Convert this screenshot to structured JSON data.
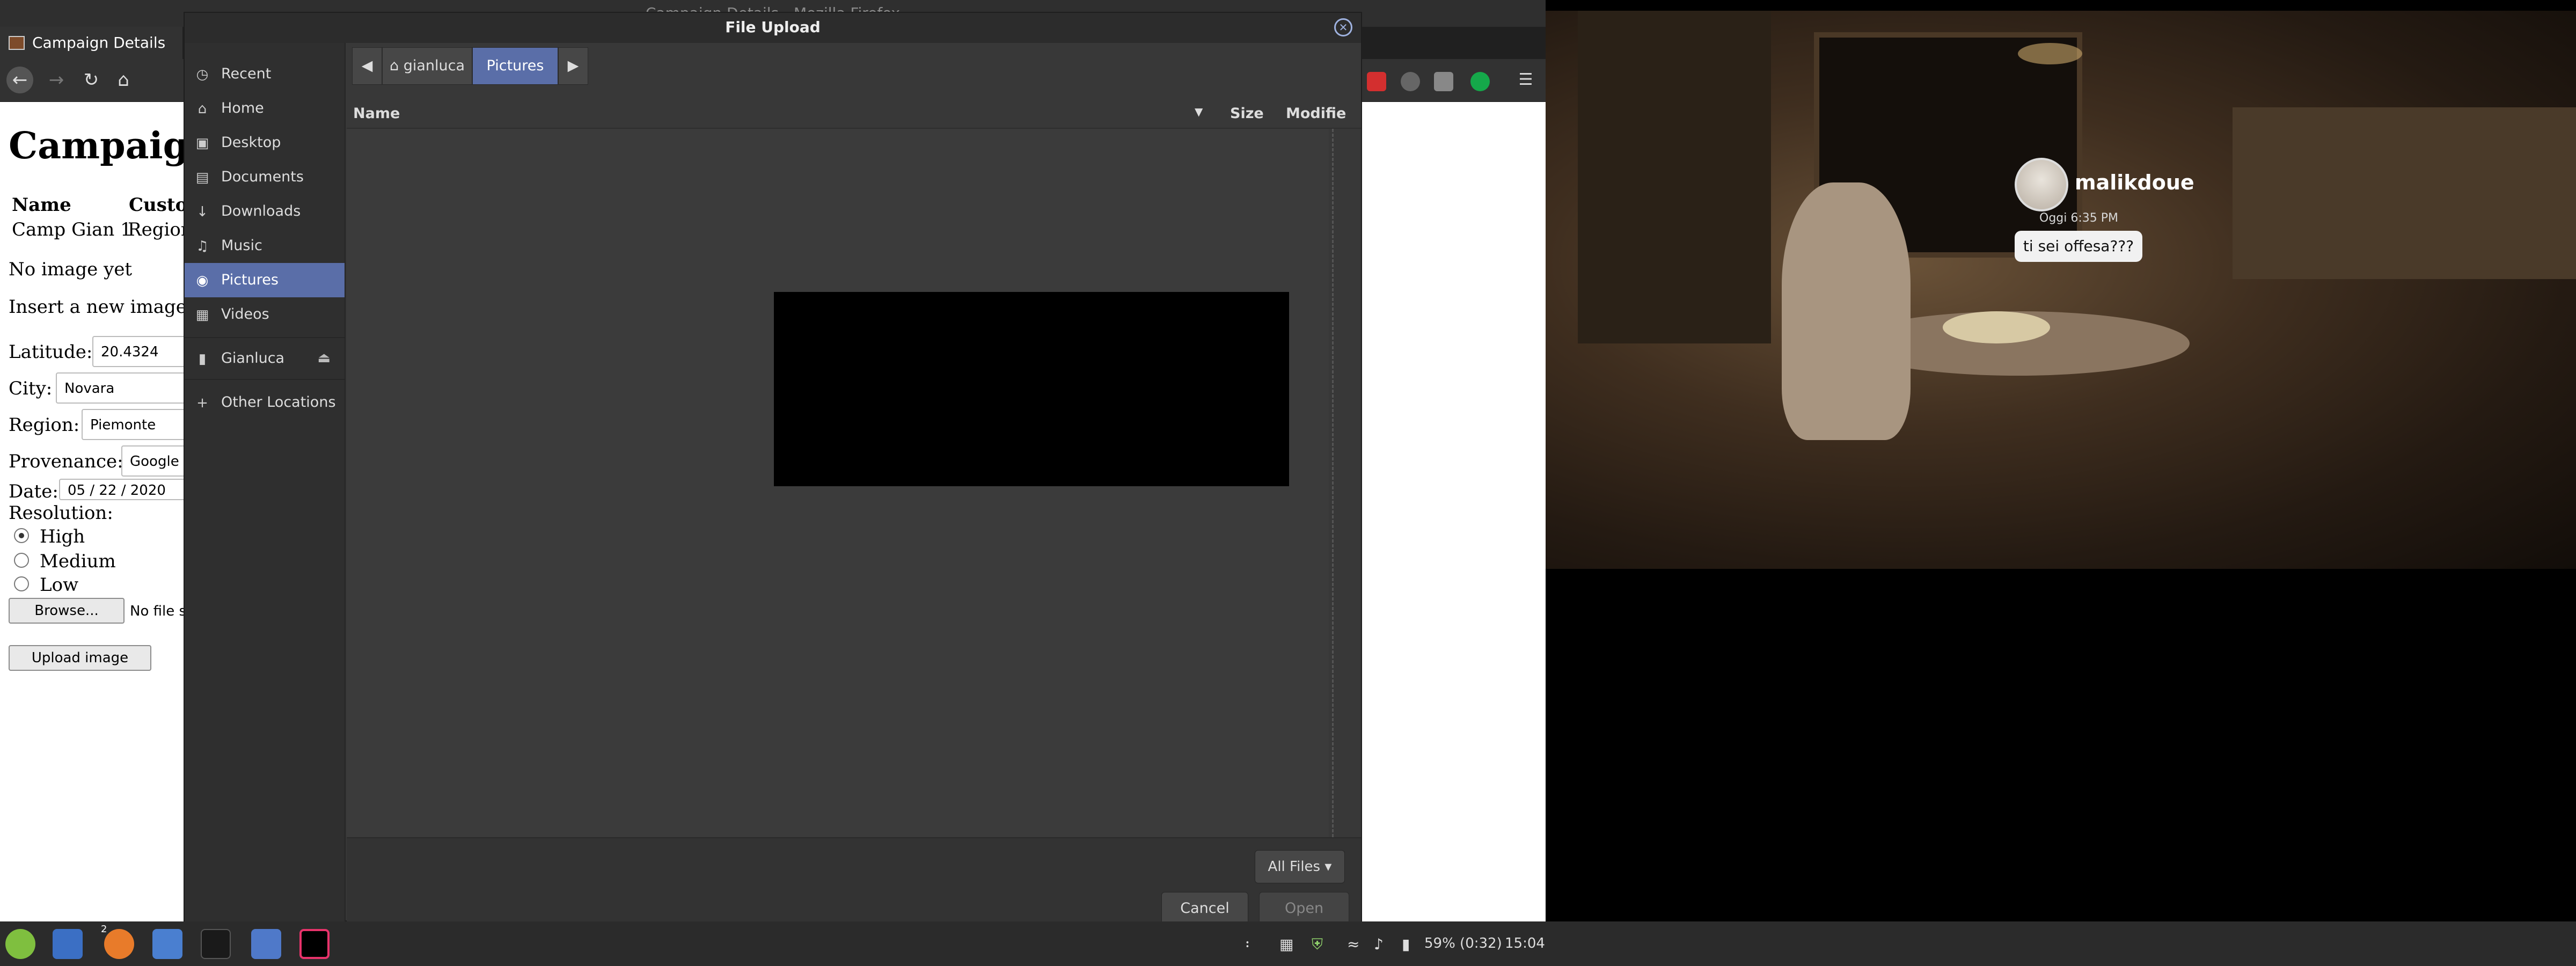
{
  "firefox": {
    "window_title": "Campaign Details - Mozilla Firefox",
    "tab_title": "Campaign Details",
    "page": {
      "heading": "Campaign",
      "table_headers": [
        "Name",
        "Custo"
      ],
      "table_row": [
        "Camp Gian 1",
        "Region"
      ],
      "no_image_text": "No image yet",
      "insert_image_text": "Insert a new image",
      "latitude_label": "Latitude:",
      "latitude_value": "20.4324",
      "city_label": "City:",
      "city_value": "Novara",
      "region_label": "Region:",
      "region_value": "Piemonte",
      "provenance_label": "Provenance:",
      "provenance_value": "Google",
      "date_label": "Date:",
      "date_value": "05 / 22 / 2020",
      "resolution_label": "Resolution:",
      "resolution_options": [
        "High",
        "Medium",
        "Low"
      ],
      "resolution_selected": "High",
      "browse_button": "Browse...",
      "no_file_text": "No file s",
      "upload_button": "Upload image"
    }
  },
  "dialog": {
    "title": "File Upload",
    "sidebar": [
      {
        "label": "Recent",
        "icon": "clock-icon"
      },
      {
        "label": "Home",
        "icon": "home-icon"
      },
      {
        "label": "Desktop",
        "icon": "desktop-icon"
      },
      {
        "label": "Documents",
        "icon": "documents-icon"
      },
      {
        "label": "Downloads",
        "icon": "downloads-icon"
      },
      {
        "label": "Music",
        "icon": "music-icon"
      },
      {
        "label": "Pictures",
        "icon": "pictures-icon"
      },
      {
        "label": "Videos",
        "icon": "videos-icon"
      },
      {
        "label": "Gianluca",
        "icon": "drive-icon"
      },
      {
        "label": "Other Locations",
        "icon": "plus-icon"
      }
    ],
    "active_place": "Pictures",
    "path": [
      "gianluca",
      "Pictures"
    ],
    "columns": [
      "Name",
      "Size",
      "Modifie"
    ],
    "filter": "All Files",
    "cancel": "Cancel",
    "open": "Open"
  },
  "video_overlay": {
    "username": "malikdoue",
    "time": "Oggi 6:35 PM",
    "message": "ti sei offesa???"
  },
  "taskbar": {
    "battery": "59% (0:32)",
    "clock": "15:04",
    "firefox_badge": "2"
  },
  "colors": {
    "accent": "#5a6ea8",
    "dialog_bg": "#383838",
    "taskbar_bg": "#2b2b2b"
  }
}
